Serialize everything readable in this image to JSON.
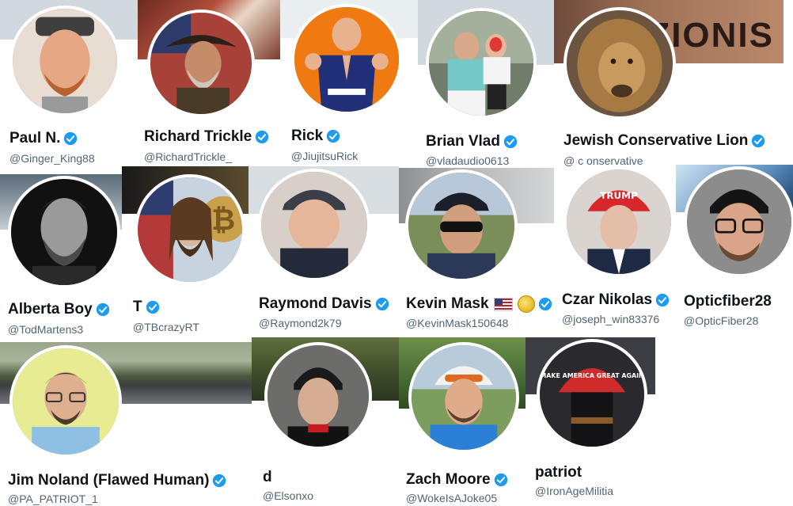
{
  "badge_color": "#1d9bf0",
  "profiles": [
    {
      "name": "Paul N.",
      "handle": "@Ginger_King88",
      "verified": true
    },
    {
      "name": "Richard Trickle",
      "handle": "@RichardTrickle_",
      "verified": true
    },
    {
      "name": "Rick",
      "handle": "@JiujitsuRick",
      "verified": true
    },
    {
      "name": "Brian Vlad",
      "handle": "@vladaudio0613",
      "verified": true
    },
    {
      "name": "Jewish Conservative Lion",
      "handle": "@ c onservative",
      "verified": true
    },
    {
      "name": "Alberta Boy",
      "handle": "@TodMartens3",
      "verified": true
    },
    {
      "name": "T",
      "handle": "@TBcrazyRT",
      "verified": true
    },
    {
      "name": "Raymond Davis",
      "handle": "@Raymond2k79",
      "verified": true
    },
    {
      "name": "Kevin Mask",
      "handle": "@KevinMask150648",
      "verified": true,
      "emojis": [
        "us-flag",
        "coin"
      ]
    },
    {
      "name": "Czar Nikolas",
      "handle": "@joseph_win83376",
      "verified": true
    },
    {
      "name": "Opticfiber28",
      "handle": "@OpticFiber28",
      "verified": false
    },
    {
      "name": "Jim Noland (Flawed Human)",
      "handle": "@PA_PATRIOT_1",
      "verified": true
    },
    {
      "name": "d",
      "handle": "@Elsonxo",
      "verified": false
    },
    {
      "name": "Zach Moore",
      "handle": "@WokeIsAJoke05",
      "verified": true
    },
    {
      "name": "patriot",
      "handle": "@IronAgeMilitia",
      "verified": false
    }
  ],
  "banner_texts": {
    "lion_sign": "ZIONIS",
    "maga_hat": "MAKE AMERICA GREAT AGAIN",
    "trump_hat": "TRUMP"
  },
  "icons": {
    "verified": "verified-badge-icon",
    "bitcoin": "bitcoin-icon"
  }
}
